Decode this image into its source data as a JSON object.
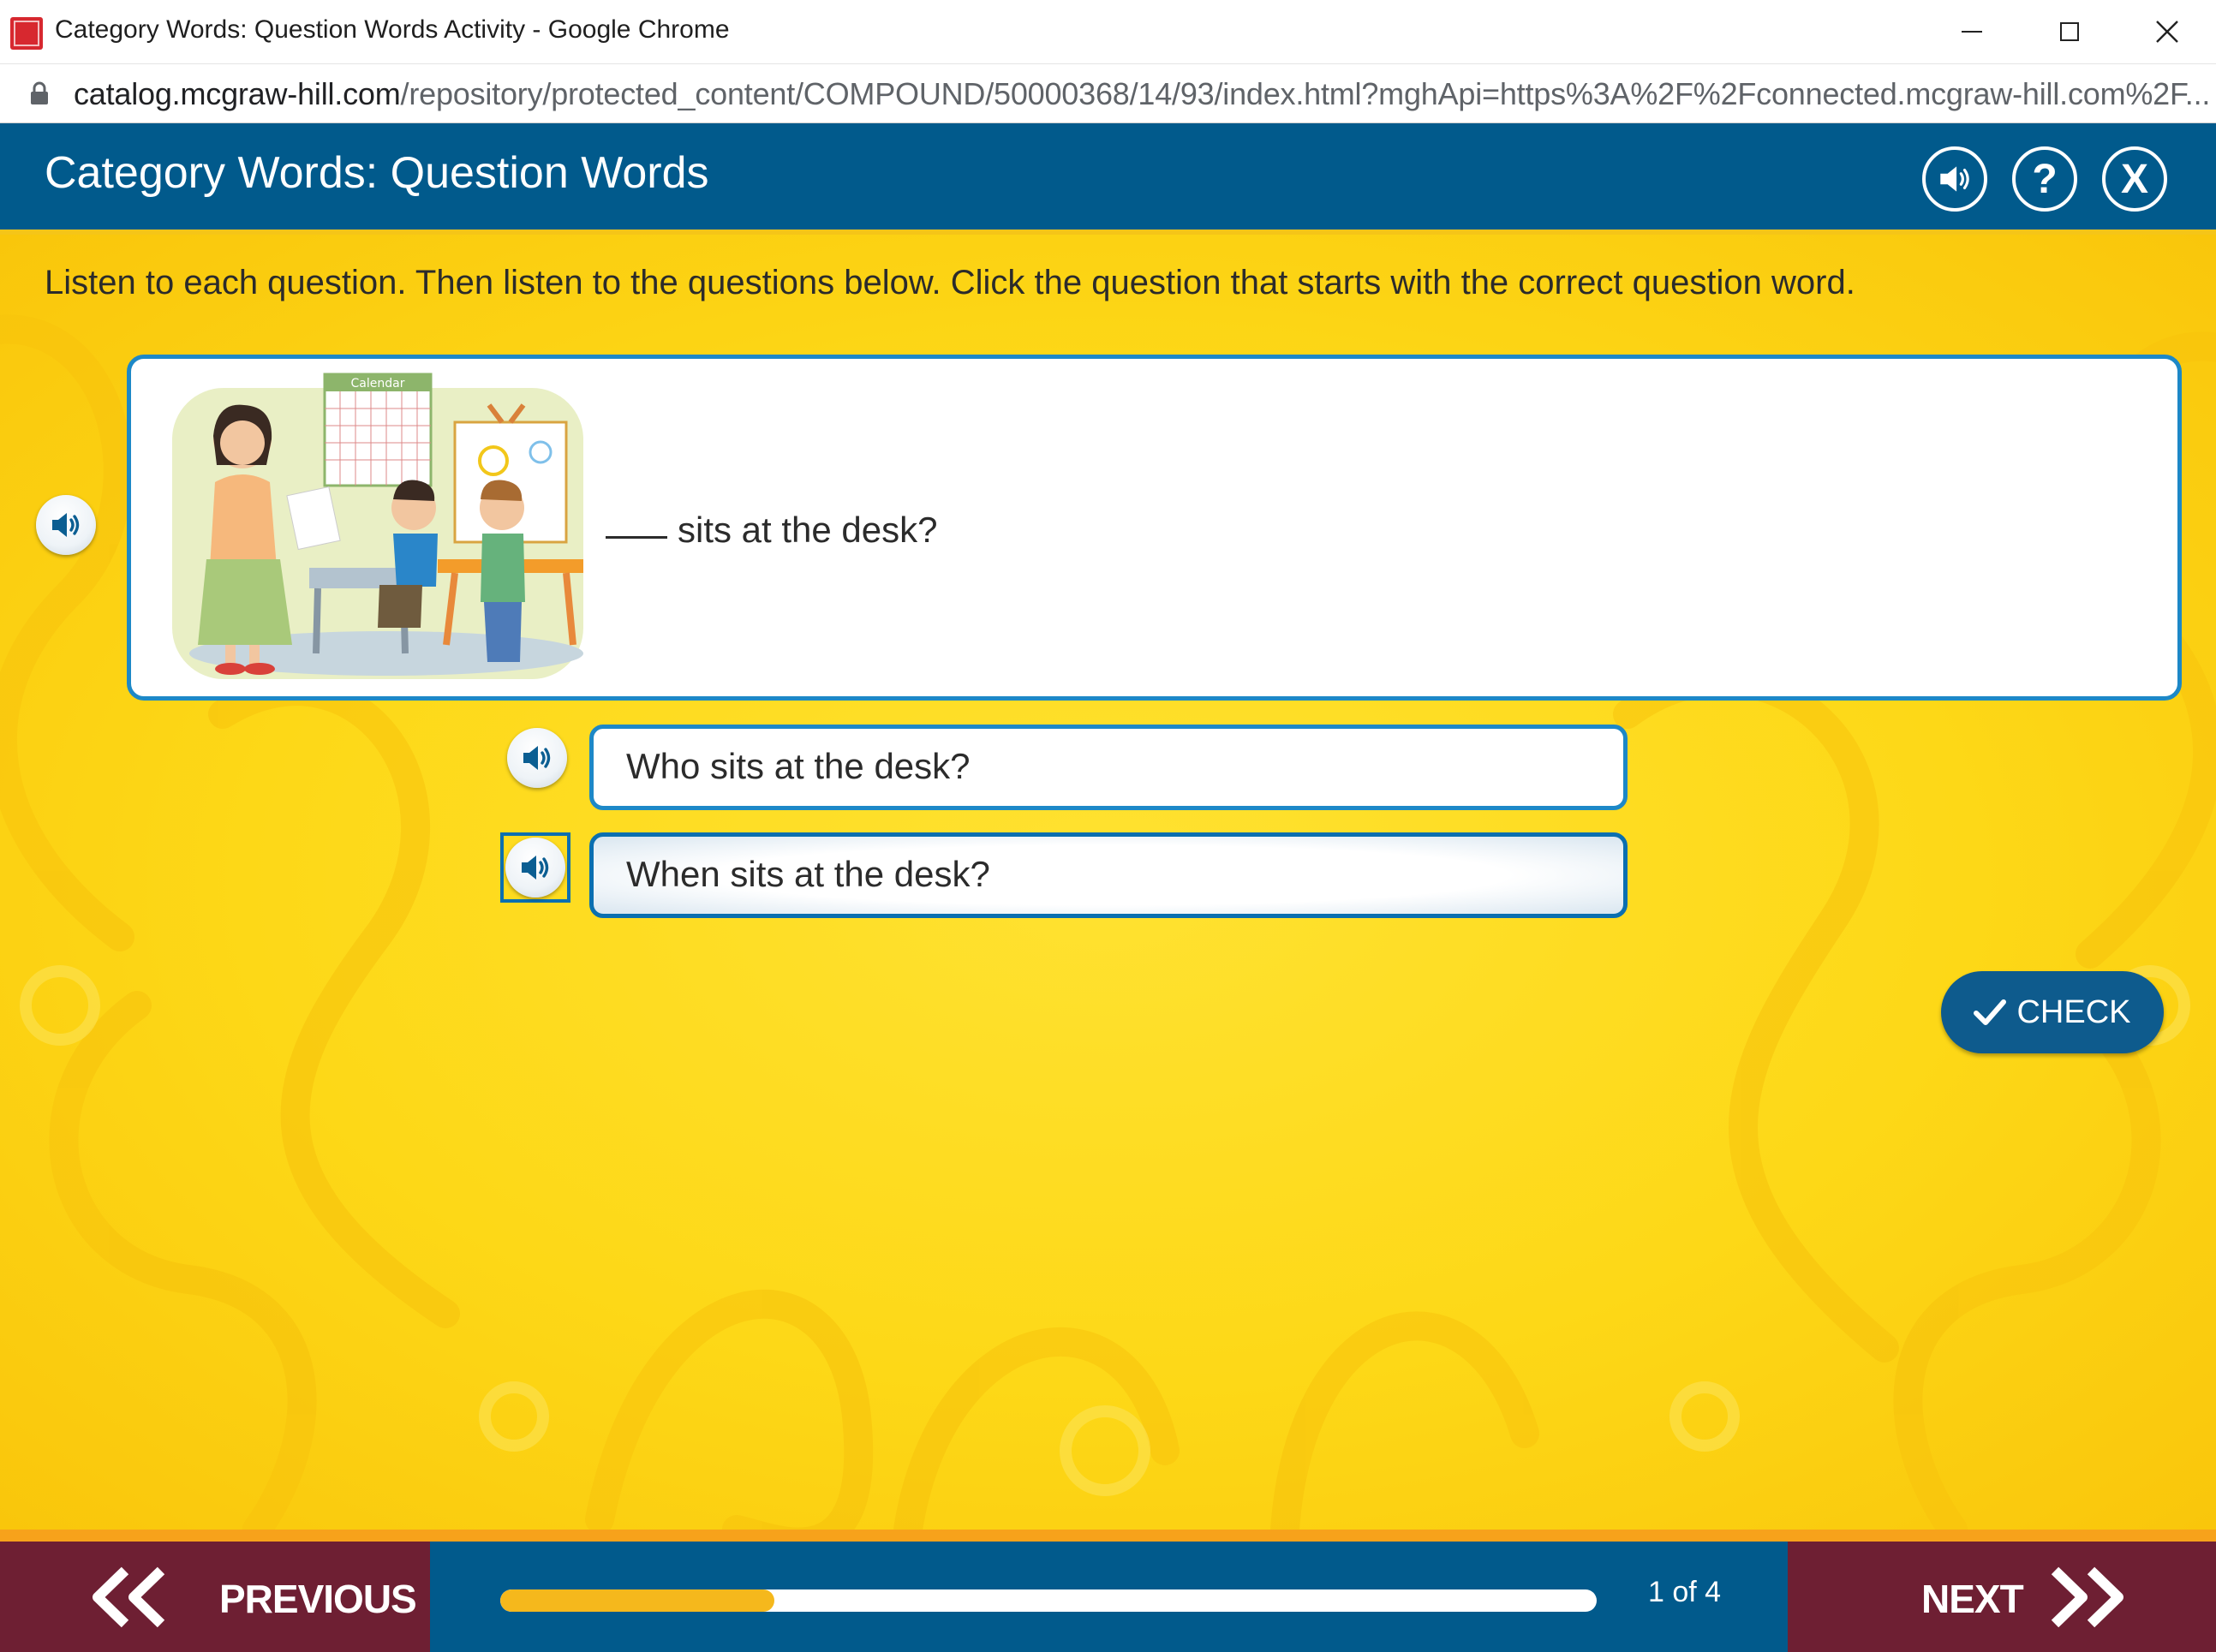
{
  "browser": {
    "window_title": "Category Words: Question Words Activity - Google Chrome",
    "url_domain": "catalog.mcgraw-hill.com",
    "url_path": "/repository/protected_content/COMPOUND/50000368/14/93/index.html?mghApi=https%3A%2F%2Fconnected.mcgraw-hill.com%2F..."
  },
  "header": {
    "title": "Category Words: Question Words",
    "help_label": "?",
    "close_label": "X"
  },
  "instructions": "Listen to each question. Then listen to the questions below. Click the question that starts with the correct question word.",
  "prompt": {
    "text": "sits at the desk?",
    "calendar_label": "Calendar"
  },
  "answers": [
    {
      "label": "Who sits at the desk?",
      "selected": false
    },
    {
      "label": "When sits at the desk?",
      "selected": true
    }
  ],
  "check_label": "CHECK",
  "nav": {
    "previous_label": "PREVIOUS",
    "next_label": "NEXT",
    "progress_text": "1 of 4",
    "progress_fraction": 0.25
  },
  "colors": {
    "header_blue": "#015a8c",
    "accent_yellow": "#fdd817",
    "nav_maroon": "#6e1f33",
    "card_border": "#1d88c7"
  },
  "icons": [
    "speaker-icon",
    "help-icon",
    "close-icon",
    "checkmark-icon",
    "double-chevron-left-icon",
    "double-chevron-right-icon",
    "lock-icon"
  ]
}
